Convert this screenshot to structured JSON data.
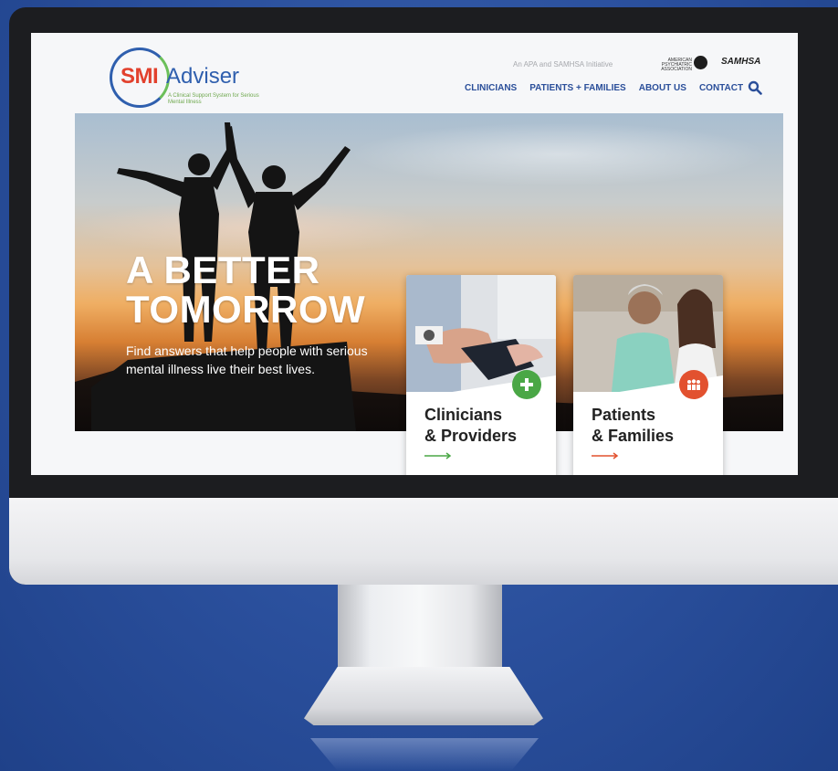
{
  "logo": {
    "name_red": "SMI",
    "name_blue": "Adviser",
    "tagline": "A Clinical Support System for Serious Mental Illness"
  },
  "header": {
    "initiative_text": "An APA and SAMHSA Initiative",
    "apa_label": "AMERICAN PSYCHIATRIC ASSOCIATION",
    "samhsa_label": "SAMHSA"
  },
  "nav": {
    "items": [
      "CLINICIANS",
      "PATIENTS + FAMILIES",
      "ABOUT US",
      "CONTACT"
    ],
    "search_icon": "search-icon"
  },
  "hero": {
    "title_line1": "A BETTER",
    "title_line2": "TOMORROW",
    "subtitle": "Find answers that help people with serious mental illness live their best lives."
  },
  "cards": [
    {
      "line1": "Clinicians",
      "line2": "& Providers",
      "icon": "plus-icon",
      "badge_color": "#4aa746",
      "arrow_color": "#4aa746"
    },
    {
      "line1": "Patients",
      "line2": "& Families",
      "icon": "people-icon",
      "badge_color": "#e2512f",
      "arrow_color": "#e2512f"
    }
  ],
  "colors": {
    "nav_text": "#2b4f9a",
    "brand_red": "#e2412d",
    "brand_blue": "#2f5fae",
    "background": "#2a4f9c"
  }
}
